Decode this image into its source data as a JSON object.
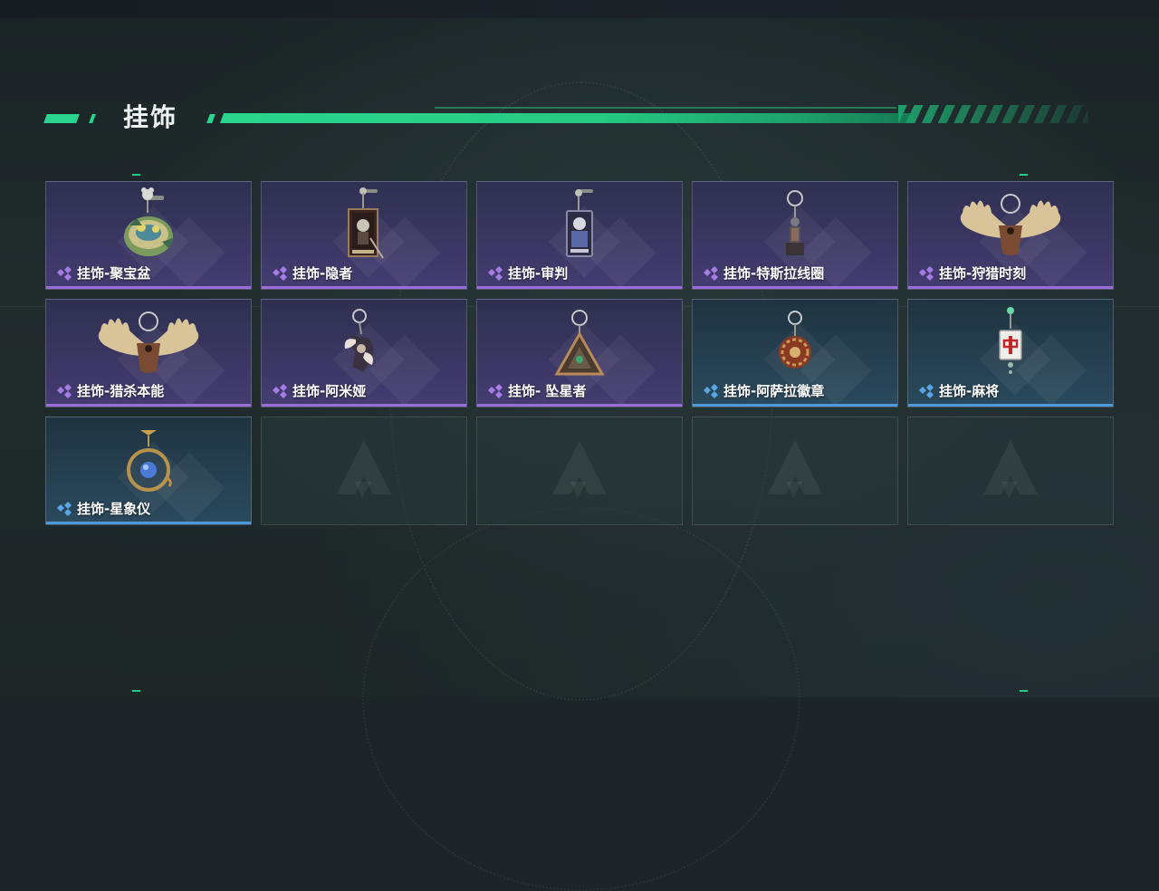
{
  "header": {
    "title": "挂饰"
  },
  "colors": {
    "accent": "#2ad68f",
    "purple_rarity": "#9a6cd8",
    "blue_rarity": "#4d9ad8"
  },
  "items": [
    {
      "label": "挂饰-聚宝盆",
      "rarity": "purple",
      "icon": "treasure-bowl-charm-icon"
    },
    {
      "label": "挂饰-隐者",
      "rarity": "purple",
      "icon": "hermit-tarot-card-charm-icon"
    },
    {
      "label": "挂饰-审判",
      "rarity": "purple",
      "icon": "judgement-tarot-card-charm-icon"
    },
    {
      "label": "挂饰-特斯拉线圈",
      "rarity": "purple",
      "icon": "tesla-coil-charm-icon"
    },
    {
      "label": "挂饰-狩猎时刻",
      "rarity": "purple",
      "icon": "moose-antler-charm-icon"
    },
    {
      "label": "挂饰-猎杀本能",
      "rarity": "purple",
      "icon": "moose-antler-charm-icon"
    },
    {
      "label": "挂饰-阿米娅",
      "rarity": "purple",
      "icon": "amiya-rabbit-charm-icon"
    },
    {
      "label": "挂饰- 坠星者",
      "rarity": "purple",
      "icon": "triangle-star-charm-icon"
    },
    {
      "label": "挂饰-阿萨拉徽章",
      "rarity": "blue",
      "icon": "asala-badge-charm-icon"
    },
    {
      "label": "挂饰-麻将",
      "rarity": "blue",
      "icon": "mahjong-tile-charm-icon"
    },
    {
      "label": "挂饰-星象仪",
      "rarity": "blue",
      "icon": "astrolabe-charm-icon"
    }
  ],
  "empty_slots": 4
}
